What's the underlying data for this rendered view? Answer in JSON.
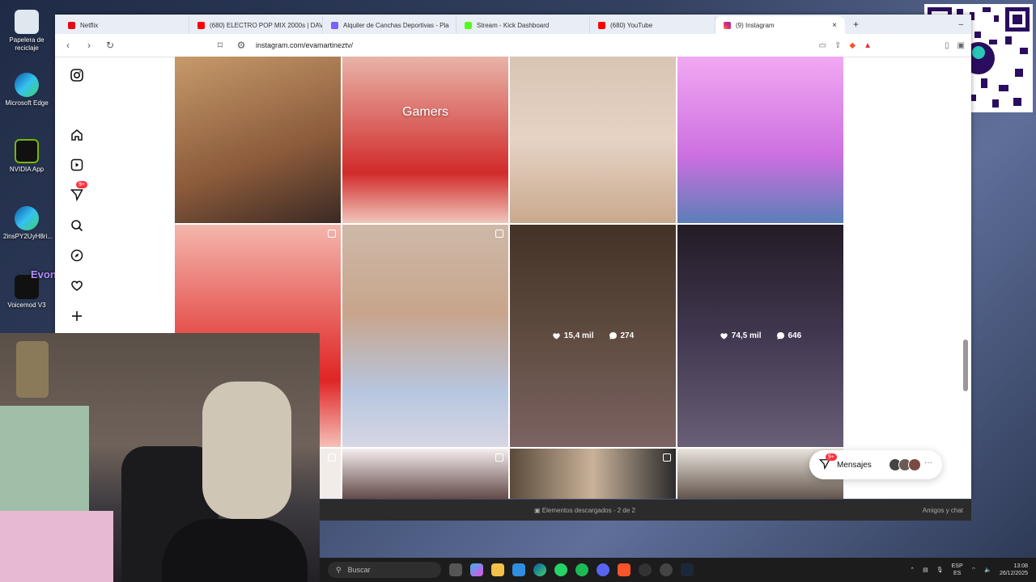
{
  "desktop": {
    "icons": [
      {
        "label": "Papelera de reciclaje",
        "icon": "recycle-bin-icon"
      },
      {
        "label": "Microsoft Edge",
        "icon": "edge-icon"
      },
      {
        "label": "NVIDIA App",
        "icon": "nvidia-icon"
      },
      {
        "label": "2insPY2UyH8ri...",
        "icon": "edge-icon"
      },
      {
        "label": "Voicemod V3",
        "icon": "voicemod-icon"
      }
    ],
    "overlay_name": "Evont"
  },
  "browser": {
    "tabs": [
      {
        "title": "Netflix",
        "color": "#e50914"
      },
      {
        "title": "(680) ELECTRO POP MIX 2000s | DAV",
        "color": "#ff0000"
      },
      {
        "title": "Alquiler de Canchas Deportivas - Pla",
        "color": "#7b61ff"
      },
      {
        "title": "Stream - Kick Dashboard",
        "color": "#53fc18"
      },
      {
        "title": "(680) YouTube",
        "color": "#ff0000"
      },
      {
        "title": "(9) Instagram",
        "color": "#d6249f",
        "active": true
      }
    ],
    "close_symbol": "×",
    "new_tab_symbol": "+",
    "minimize_symbol": "–",
    "url": "instagram.com/evamartineztv/"
  },
  "instagram": {
    "notifications_badge": "9+",
    "hover_post": {
      "likes": "15,4 mil",
      "comments": "274"
    },
    "second_post": {
      "likes": "74,5 mil",
      "comments": "646"
    },
    "tile_text": "Gamers",
    "messages": {
      "label": "Mensajes",
      "badge": "9+"
    }
  },
  "download_bar": {
    "status": "Elementos descargados - 2 de 2",
    "right_label": "Amigos y chat"
  },
  "taskbar": {
    "search_placeholder": "Buscar",
    "lang_top": "ESP",
    "lang_bottom": "ES",
    "time": "13:08",
    "date": "26/12/2025"
  }
}
